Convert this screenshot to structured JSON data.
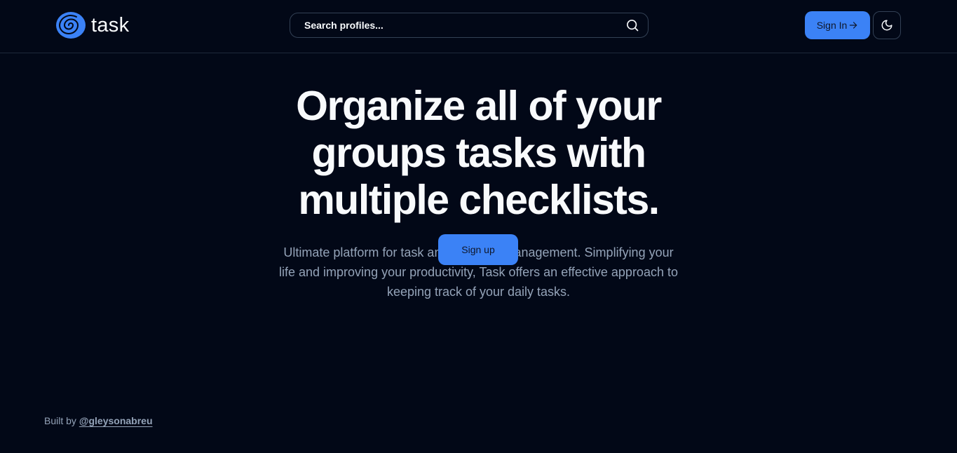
{
  "header": {
    "logo_text": "task",
    "search": {
      "placeholder": "Search profiles...",
      "value": ""
    },
    "signin_label": "Sign In",
    "icons": {
      "logo": "spiral-logo-icon",
      "search": "search-icon",
      "signin_arrow": "arrow-right-icon",
      "theme": "moon-icon"
    }
  },
  "hero": {
    "title": "Organize all of your groups tasks with multiple checklists.",
    "subtitle": "Ultimate platform for task and checklist management. Simplifying your life and improving your productivity, Task offers an effective approach to keeping track of your daily tasks.",
    "signup_label": "Sign up"
  },
  "footer": {
    "prefix": "Built by",
    "author_link": "@gleysonabreu"
  },
  "colors": {
    "background": "#020817",
    "accent": "#3b82f6",
    "border": "#1e293b",
    "muted_text": "#94a3b8"
  }
}
